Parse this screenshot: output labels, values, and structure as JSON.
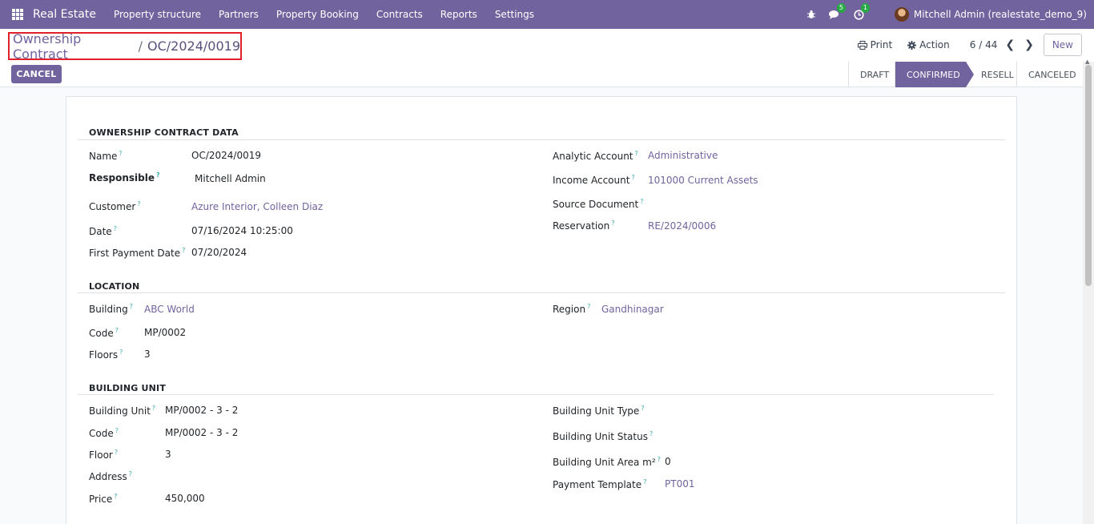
{
  "navbar": {
    "brand": "Real Estate",
    "menu": [
      "Property structure",
      "Partners",
      "Property Booking",
      "Contracts",
      "Reports",
      "Settings"
    ],
    "chat_badge": "5",
    "activity_badge": "1",
    "user_name": "Mitchell Admin (realestate_demo_9)",
    "bug_icon": "bug-icon",
    "chat_icon": "chat-icon",
    "activity_icon": "clock-icon"
  },
  "control_panel": {
    "breadcrumb_parent": "Ownership Contract",
    "breadcrumb_separator": "/",
    "breadcrumb_current": "OC/2024/0019",
    "print_label": "Print",
    "action_label": "Action",
    "pager": "6 / 44",
    "new_label": "New",
    "cancel_label": "CANCEL"
  },
  "statusbar": {
    "stages": [
      "DRAFT",
      "CONFIRMED",
      "RESELL",
      "CANCELED"
    ],
    "active": "CONFIRMED"
  },
  "sections": {
    "contract": {
      "title": "OWNERSHIP CONTRACT DATA",
      "name_label": "Name",
      "name_value": "OC/2024/0019",
      "responsible_label": "Responsible",
      "responsible_value": "Mitchell Admin",
      "customer_label": "Customer",
      "customer_value": "Azure Interior, Colleen Diaz",
      "date_label": "Date",
      "date_value": "07/16/2024 10:25:00",
      "first_payment_label": "First Payment Date",
      "first_payment_value": "07/20/2024",
      "analytic_label": "Analytic Account",
      "analytic_value": "Administrative",
      "income_label": "Income Account",
      "income_value": "101000 Current Assets",
      "source_label": "Source Document",
      "source_value": "",
      "reservation_label": "Reservation",
      "reservation_value": "RE/2024/0006"
    },
    "location": {
      "title": "LOCATION",
      "building_label": "Building",
      "building_value": "ABC World",
      "code_label": "Code",
      "code_value": "MP/0002",
      "floors_label": "Floors",
      "floors_value": "3",
      "region_label": "Region",
      "region_value": "Gandhinagar"
    },
    "unit": {
      "title": "BUILDING UNIT",
      "unit_label": "Building Unit",
      "unit_value": "MP/0002 - 3 - 2",
      "code_label": "Code",
      "code_value": "MP/0002 - 3 - 2",
      "floor_label": "Floor",
      "floor_value": "3",
      "address_label": "Address",
      "address_value": "",
      "price_label": "Price",
      "price_value": "450,000",
      "type_label": "Building Unit Type",
      "type_value": "",
      "status_label": "Building Unit Status",
      "status_value": "",
      "area_label": "Building Unit Area m²",
      "area_value": "0",
      "template_label": "Payment Template",
      "template_value": "PT001"
    }
  },
  "help_mark": "?"
}
